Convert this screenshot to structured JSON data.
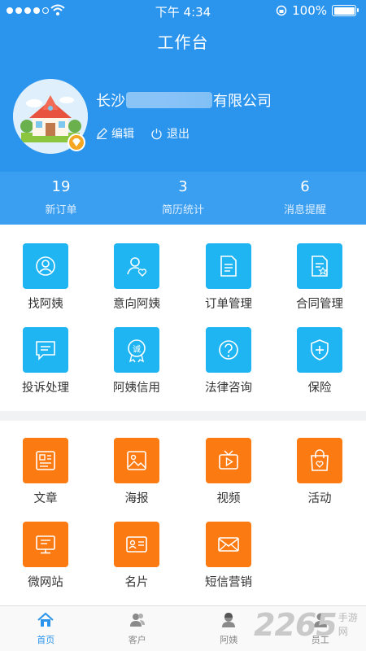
{
  "status": {
    "time": "下午 4:34",
    "battery": "100%"
  },
  "header": {
    "title": "工作台"
  },
  "profile": {
    "name_prefix": "长沙",
    "name_suffix": "有限公司",
    "edit_label": "编辑",
    "logout_label": "退出"
  },
  "stats": [
    {
      "value": "19",
      "label": "新订单"
    },
    {
      "value": "3",
      "label": "简历统计"
    },
    {
      "value": "6",
      "label": "消息提醒"
    }
  ],
  "service_grid": [
    {
      "label": "找阿姨",
      "icon": "search-person-icon"
    },
    {
      "label": "意向阿姨",
      "icon": "heart-person-icon"
    },
    {
      "label": "订单管理",
      "icon": "order-doc-icon"
    },
    {
      "label": "合同管理",
      "icon": "contract-doc-icon"
    },
    {
      "label": "投诉处理",
      "icon": "complaint-chat-icon"
    },
    {
      "label": "阿姨信用",
      "icon": "credit-badge-icon"
    },
    {
      "label": "法律咨询",
      "icon": "question-icon"
    },
    {
      "label": "保险",
      "icon": "shield-plus-icon"
    }
  ],
  "credit_badge_text": "诚",
  "marketing_grid": [
    {
      "label": "文章",
      "icon": "article-icon"
    },
    {
      "label": "海报",
      "icon": "poster-icon"
    },
    {
      "label": "视频",
      "icon": "video-tv-icon"
    },
    {
      "label": "活动",
      "icon": "activity-bag-icon"
    },
    {
      "label": "微网站",
      "icon": "microsite-monitor-icon"
    },
    {
      "label": "名片",
      "icon": "business-card-icon"
    },
    {
      "label": "短信营销",
      "icon": "sms-envelope-icon"
    }
  ],
  "tabs": [
    {
      "label": "首页",
      "icon": "home-icon",
      "active": true
    },
    {
      "label": "客户",
      "icon": "customers-icon"
    },
    {
      "label": "阿姨",
      "icon": "nanny-icon"
    },
    {
      "label": "员工",
      "icon": "staff-icon"
    }
  ],
  "watermark": {
    "number": "2265",
    "text": "手游网"
  },
  "colors": {
    "primary": "#2b95ee",
    "tile_blue": "#1fb4f2",
    "tile_orange": "#fb7a12"
  }
}
